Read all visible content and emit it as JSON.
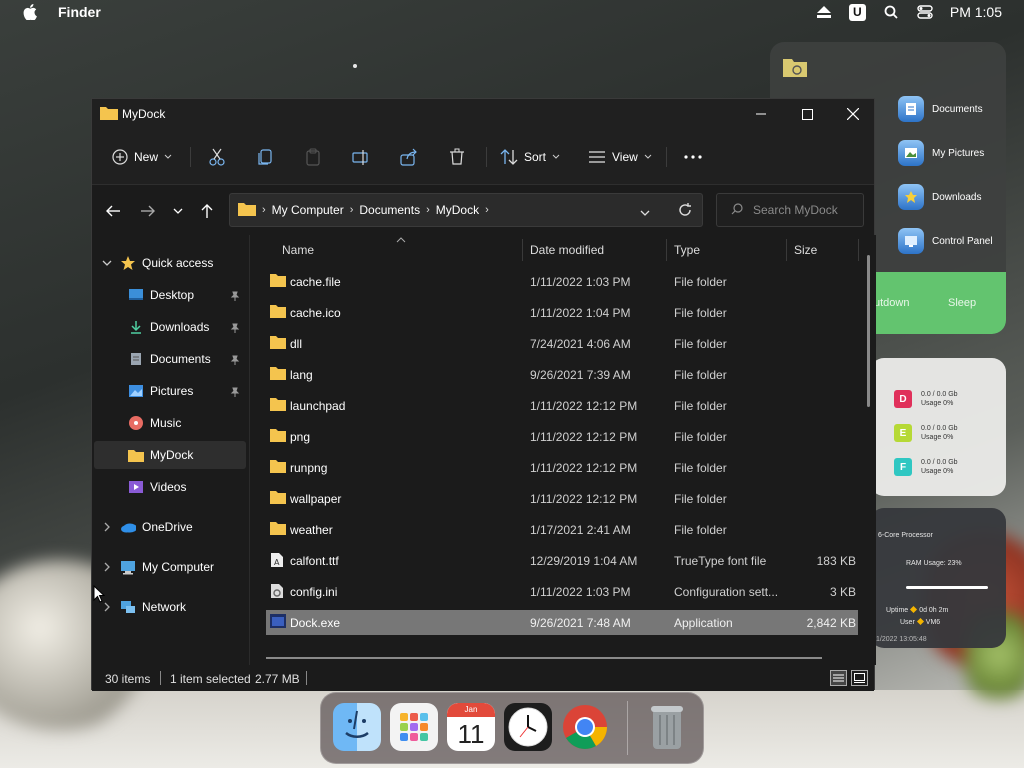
{
  "menubar": {
    "app_name": "Finder",
    "clock": "PM 1:05",
    "badge": "U"
  },
  "widgets": {
    "shortcuts": [
      {
        "label": "Documents",
        "icon": "documents-icon"
      },
      {
        "label": "My Pictures",
        "icon": "pictures-icon"
      },
      {
        "label": "Downloads",
        "icon": "downloads-icon"
      },
      {
        "label": "Control Panel",
        "icon": "control-panel-icon"
      }
    ],
    "power": {
      "shutdown": "utdown",
      "sleep": "Sleep"
    },
    "drives": [
      {
        "letter": "D",
        "color": "#e0305a",
        "usage": "0.0 / 0.0 Gb",
        "percent": "Usage 0%"
      },
      {
        "letter": "E",
        "color": "#b6d936",
        "usage": "0.0 / 0.0 Gb",
        "percent": "Usage 0%"
      },
      {
        "letter": "F",
        "color": "#2fc7c2",
        "usage": "0.0 / 0.0 Gb",
        "percent": "Usage 0%"
      }
    ],
    "stats": {
      "processor": "6-Core Processor",
      "ram": "RAM Usage: 23%",
      "uptime_label": "Uptime",
      "uptime_value": "0d 0h 2m",
      "user_label": "User",
      "user_value": "VM6",
      "timestamp": "1/2022 13:05:48"
    }
  },
  "explorer": {
    "title": "MyDock",
    "toolbar": {
      "new_label": "New",
      "sort_label": "Sort",
      "view_label": "View"
    },
    "breadcrumb": [
      "My Computer",
      "Documents",
      "MyDock"
    ],
    "search_placeholder": "Search MyDock",
    "nav": {
      "quick_access": "Quick access",
      "items": [
        {
          "label": "Desktop",
          "pinned": true
        },
        {
          "label": "Downloads",
          "pinned": true
        },
        {
          "label": "Documents",
          "pinned": true
        },
        {
          "label": "Pictures",
          "pinned": true
        },
        {
          "label": "Music",
          "pinned": false
        },
        {
          "label": "MyDock",
          "pinned": false
        },
        {
          "label": "Videos",
          "pinned": false
        }
      ],
      "onedrive": "OneDrive",
      "my_computer": "My Computer",
      "network": "Network"
    },
    "columns": {
      "name": "Name",
      "date": "Date modified",
      "type": "Type",
      "size": "Size"
    },
    "files": [
      {
        "name": "cache.file",
        "date": "1/11/2022 1:03 PM",
        "type": "File folder",
        "size": "",
        "icon": "folder"
      },
      {
        "name": "cache.ico",
        "date": "1/11/2022 1:04 PM",
        "type": "File folder",
        "size": "",
        "icon": "folder"
      },
      {
        "name": "dll",
        "date": "7/24/2021 4:06 AM",
        "type": "File folder",
        "size": "",
        "icon": "folder"
      },
      {
        "name": "lang",
        "date": "9/26/2021 7:39 AM",
        "type": "File folder",
        "size": "",
        "icon": "folder"
      },
      {
        "name": "launchpad",
        "date": "1/11/2022 12:12 PM",
        "type": "File folder",
        "size": "",
        "icon": "folder"
      },
      {
        "name": "png",
        "date": "1/11/2022 12:12 PM",
        "type": "File folder",
        "size": "",
        "icon": "folder"
      },
      {
        "name": "runpng",
        "date": "1/11/2022 12:12 PM",
        "type": "File folder",
        "size": "",
        "icon": "folder"
      },
      {
        "name": "wallpaper",
        "date": "1/11/2022 12:12 PM",
        "type": "File folder",
        "size": "",
        "icon": "folder"
      },
      {
        "name": "weather",
        "date": "1/17/2021 2:41 AM",
        "type": "File folder",
        "size": "",
        "icon": "folder"
      },
      {
        "name": "calfont.ttf",
        "date": "12/29/2019 1:04 AM",
        "type": "TrueType font file",
        "size": "183 KB",
        "icon": "font"
      },
      {
        "name": "config.ini",
        "date": "1/11/2022 1:03 PM",
        "type": "Configuration sett...",
        "size": "3 KB",
        "icon": "config"
      },
      {
        "name": "Dock.exe",
        "date": "9/26/2021 7:48 AM",
        "type": "Application",
        "size": "2,842 KB",
        "icon": "exe",
        "selected": true
      }
    ],
    "status": {
      "count": "30 items",
      "selected": "1 item selected",
      "size": "2.77 MB"
    }
  },
  "dock": {
    "calendar_month": "Jan",
    "calendar_day": "11",
    "apps": [
      "finder-icon",
      "launchpad-icon",
      "calendar-icon",
      "clock-icon",
      "chrome-icon",
      "trash-icon"
    ]
  },
  "colors": {
    "folder": "#f4c44e",
    "accent": "#4a9fe8",
    "window_bg": "#1b1b1b",
    "selected_row": "#777777",
    "power_green": "#63c46f"
  }
}
